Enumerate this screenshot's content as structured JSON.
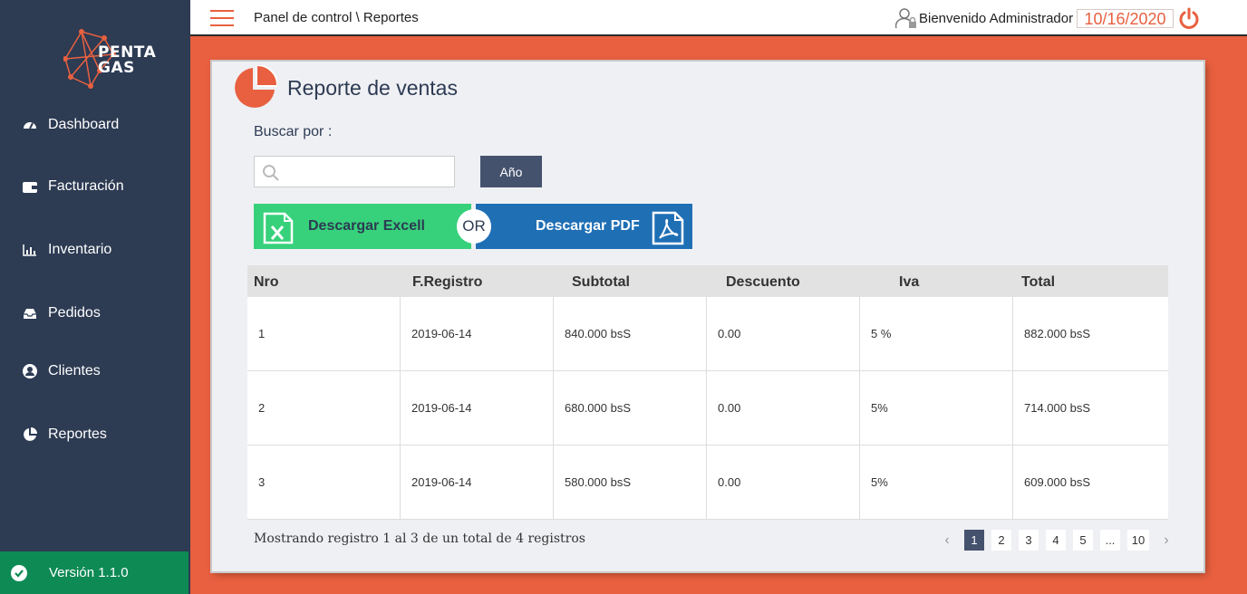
{
  "header": {
    "breadcrumb": "Panel de control \\  Reportes",
    "welcome": "Bienvenido Administrador",
    "date": "10/16/2020"
  },
  "sidebar": {
    "logo_line1": "PENTA",
    "logo_line2": "GAS",
    "items": [
      {
        "label": "Dashboard",
        "icon": "dashboard-icon"
      },
      {
        "label": "Facturación",
        "icon": "wallet-icon"
      },
      {
        "label": "Inventario",
        "icon": "bar-chart-icon"
      },
      {
        "label": "Pedidos",
        "icon": "inbox-icon"
      },
      {
        "label": "Clientes",
        "icon": "user-circle-icon"
      },
      {
        "label": "Reportes",
        "icon": "pie-chart-icon"
      }
    ],
    "version": "Versión 1.1.0"
  },
  "report": {
    "title": "Reporte de ventas",
    "search_label": "Buscar por :",
    "search_value": "",
    "year_button": "Año",
    "excel_button": "Descargar Excell",
    "or_label": "OR",
    "pdf_button": "Descargar PDF",
    "columns": [
      "Nro",
      "F.Registro",
      "Subtotal",
      "Descuento",
      "Iva",
      "Total"
    ],
    "rows": [
      [
        "1",
        "2019-06-14",
        "840.000 bsS",
        "0.00",
        "5 %",
        "882.000 bsS"
      ],
      [
        "2",
        "2019-06-14",
        "680.000 bsS",
        "0.00",
        "5%",
        "714.000 bsS"
      ],
      [
        "3",
        "2019-06-14",
        "580.000 bsS",
        "0.00",
        "5%",
        "609.000 bsS"
      ]
    ],
    "footer": "Mostrando registro 1 al 3  de un total de 4  registros",
    "pagination": [
      "1",
      "2",
      "3",
      "4",
      "5",
      "...",
      "10"
    ],
    "active_page": "1"
  },
  "colors": {
    "sidebar": "#2d3b53",
    "accent": "#e8603f",
    "excel": "#37d17b",
    "pdf": "#1f6fb5",
    "version": "#0e8a55"
  }
}
